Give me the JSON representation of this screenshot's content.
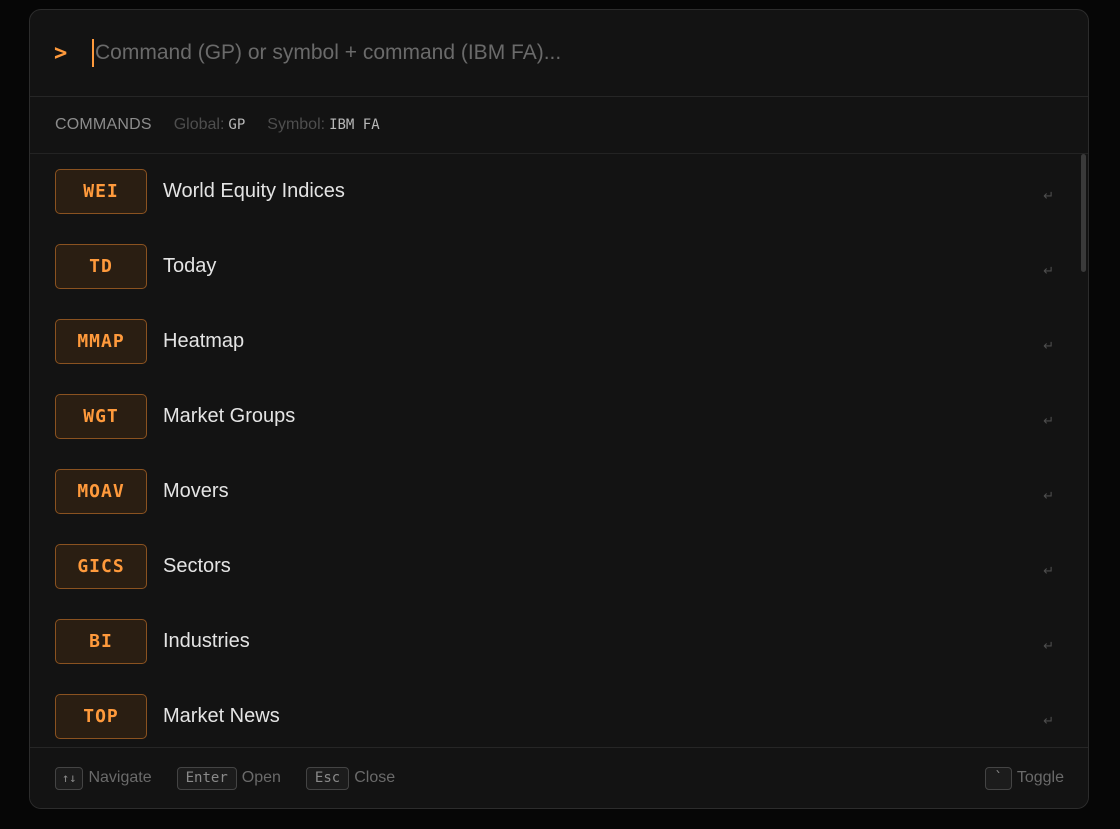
{
  "search": {
    "prompt": ">",
    "placeholder": "Command (GP) or symbol + command (IBM FA)..."
  },
  "hints": {
    "title": "COMMANDS",
    "global_label": "Global:",
    "global_code": "GP",
    "symbol_label": "Symbol:",
    "symbol_code": "IBM FA"
  },
  "commands": [
    {
      "code": "WEI",
      "label": "World Equity Indices"
    },
    {
      "code": "TD",
      "label": "Today"
    },
    {
      "code": "MMAP",
      "label": "Heatmap"
    },
    {
      "code": "WGT",
      "label": "Market Groups"
    },
    {
      "code": "MOAV",
      "label": "Movers"
    },
    {
      "code": "GICS",
      "label": "Sectors"
    },
    {
      "code": "BI",
      "label": "Industries"
    },
    {
      "code": "TOP",
      "label": "Market News"
    }
  ],
  "enter_glyph": "↵",
  "footer": {
    "navigate_key": "↑↓",
    "navigate_label": "Navigate",
    "enter_key": "Enter",
    "enter_label": "Open",
    "esc_key": "Esc",
    "esc_label": "Close",
    "toggle_key": "`",
    "toggle_label": "Toggle"
  },
  "colors": {
    "accent": "#ff9a3c",
    "badge_bg": "#2a1e12",
    "badge_border": "#8a5220",
    "panel_bg": "#131313"
  }
}
